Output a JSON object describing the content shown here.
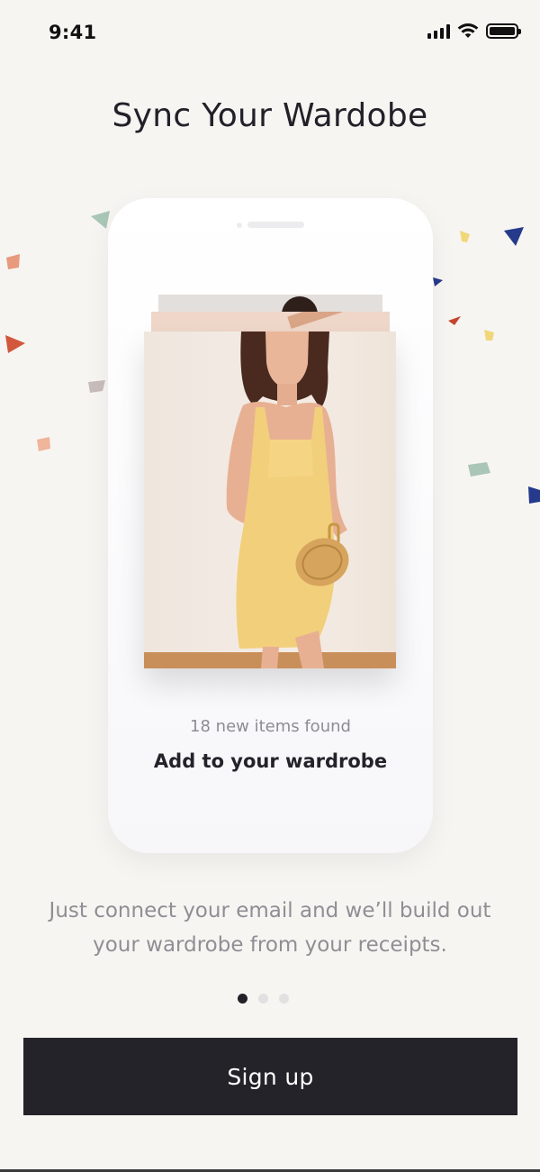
{
  "status_bar": {
    "time": "9:41"
  },
  "title": "Sync Your Wardobe",
  "card": {
    "subtitle": "18 new items found",
    "title": "Add to your wardrobe"
  },
  "description": "Just connect your email and we’ll build out your wardrobe from your receipts.",
  "pager": {
    "total": 3,
    "active": 1
  },
  "cta": {
    "label": "Sign up"
  },
  "colors": {
    "background": "#f7f5f2",
    "button": "#24232a",
    "dress": "#f2cf7a",
    "confetti": [
      "#a9c6b6",
      "#e79a7c",
      "#d2573c",
      "#c9bcbc",
      "#f0b59a",
      "#f0d779",
      "#263a8c",
      "#c5452d"
    ]
  }
}
